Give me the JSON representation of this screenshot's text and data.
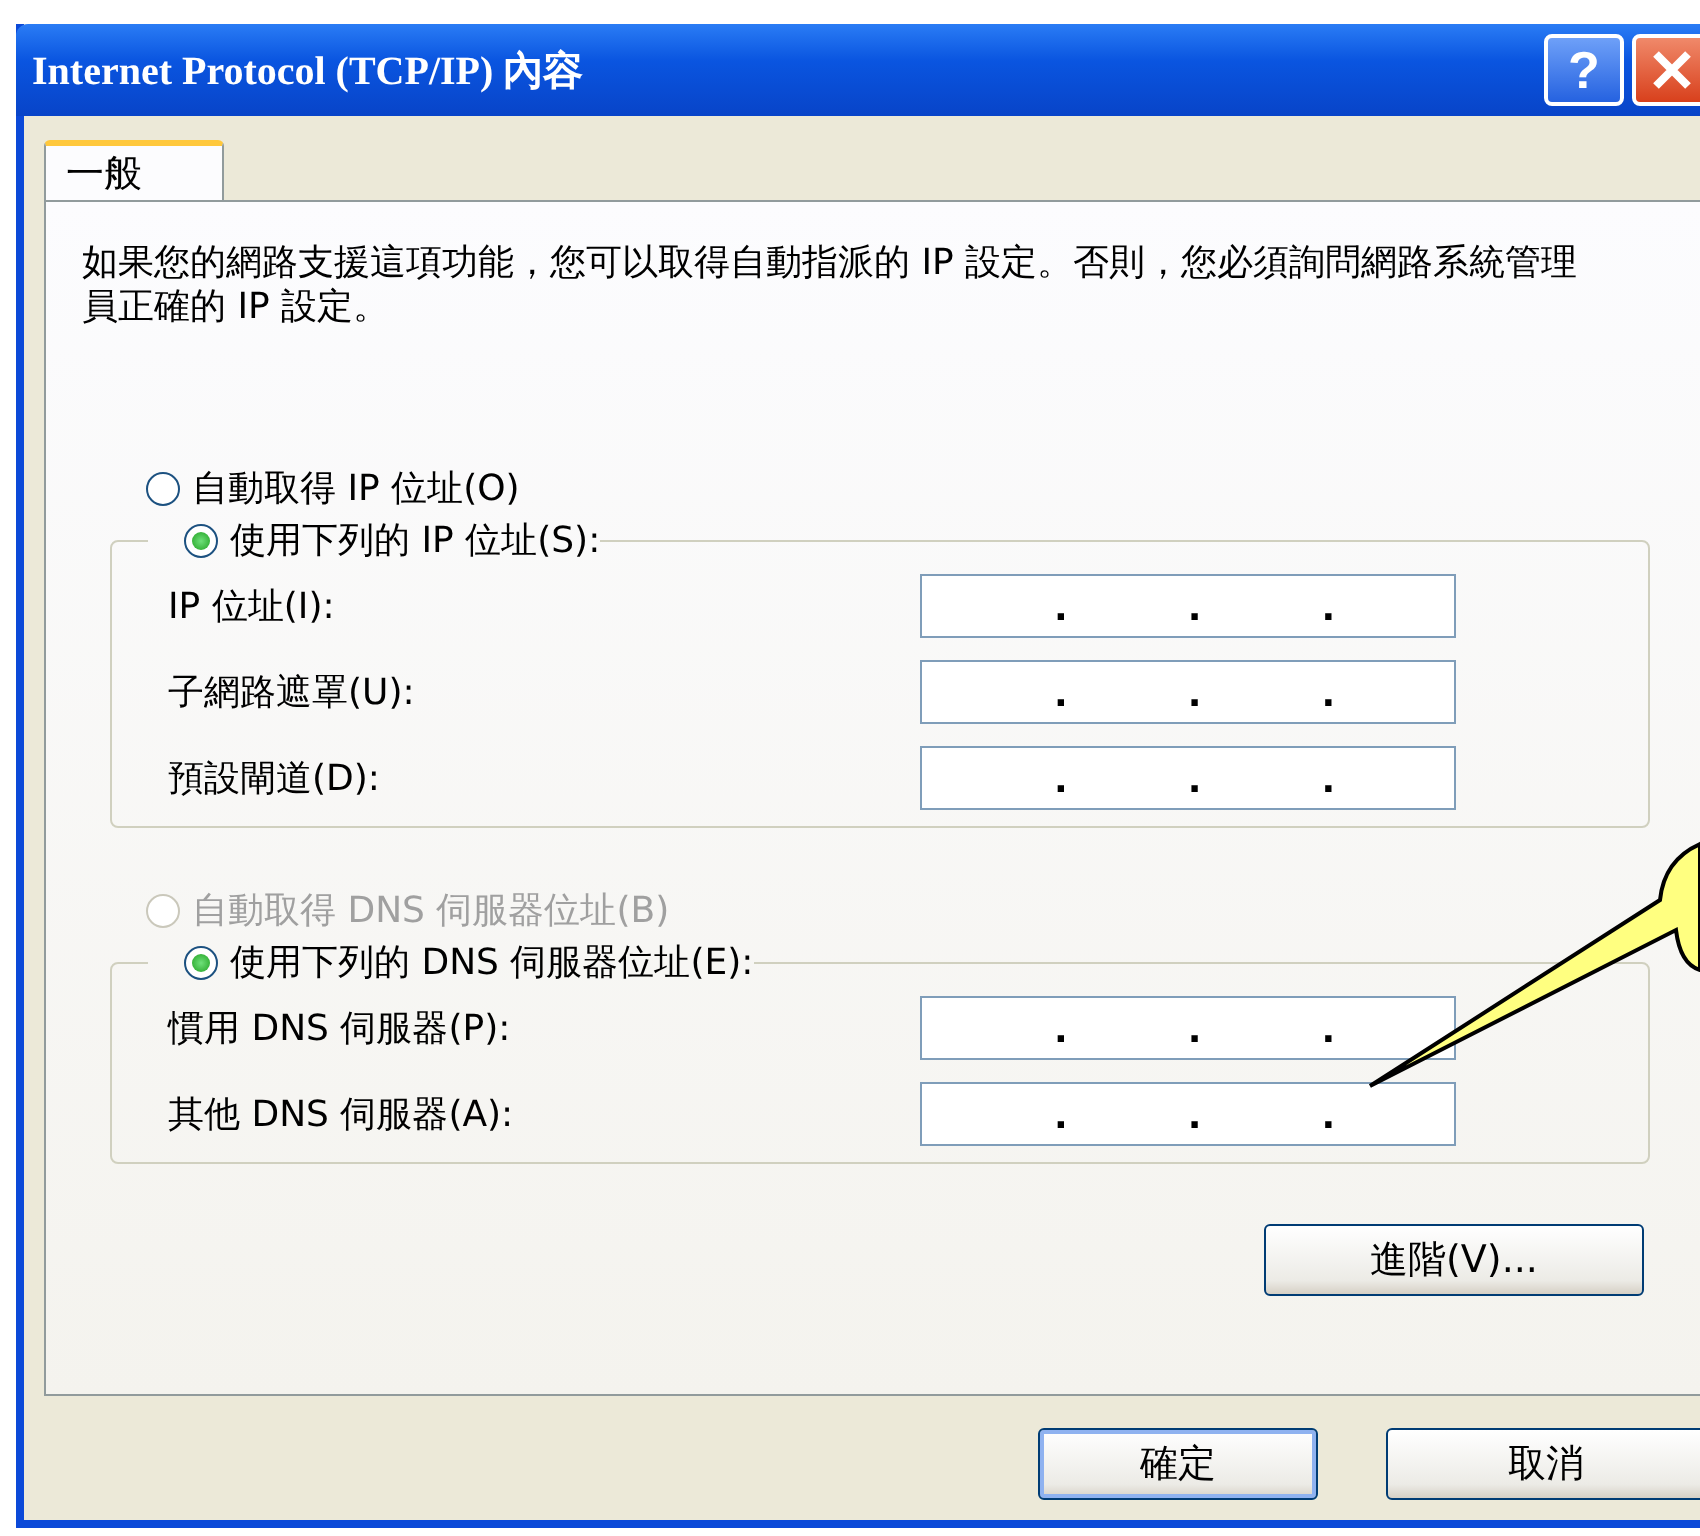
{
  "window": {
    "title": "Internet Protocol (TCP/IP) 內容",
    "title_buttons": [
      {
        "kind": "help",
        "label": "?"
      },
      {
        "kind": "close"
      }
    ]
  },
  "tabs": [
    {
      "label": "一般",
      "selected": true
    }
  ],
  "description": "如果您的網路支援這項功能，您可以取得自動指派的 IP 設定。否則，您必須詢問網路系統管理員正確的 IP 設定。",
  "sections": [
    {
      "auto_option": {
        "label": "自動取得 IP 位址(O)",
        "selected": false,
        "disabled": false
      },
      "manual_option": {
        "label": "使用下列的 IP 位址(S):",
        "selected": true,
        "disabled": false
      },
      "fields": [
        {
          "label": "IP 位址(I):",
          "separators": [
            ".",
            ".",
            "."
          ]
        },
        {
          "label": "子網路遮罩(U):",
          "separators": [
            ".",
            ".",
            "."
          ]
        },
        {
          "label": "預設閘道(D):",
          "separators": [
            ".",
            ".",
            "."
          ]
        }
      ]
    },
    {
      "auto_option": {
        "label": "自動取得 DNS 伺服器位址(B)",
        "selected": false,
        "disabled": true
      },
      "manual_option": {
        "label": "使用下列的 DNS 伺服器位址(E):",
        "selected": true,
        "disabled": false
      },
      "fields": [
        {
          "label": "慣用 DNS 伺服器(P):",
          "separators": [
            ".",
            ".",
            "."
          ]
        },
        {
          "label": "其他 DNS 伺服器(A):",
          "separators": [
            ".",
            ".",
            "."
          ]
        }
      ]
    }
  ],
  "advanced_button": "進階(V)...",
  "buttons": [
    {
      "label": "確定",
      "default": true
    },
    {
      "label": "取消",
      "default": false
    }
  ],
  "callout": {
    "kind": "pointer"
  }
}
